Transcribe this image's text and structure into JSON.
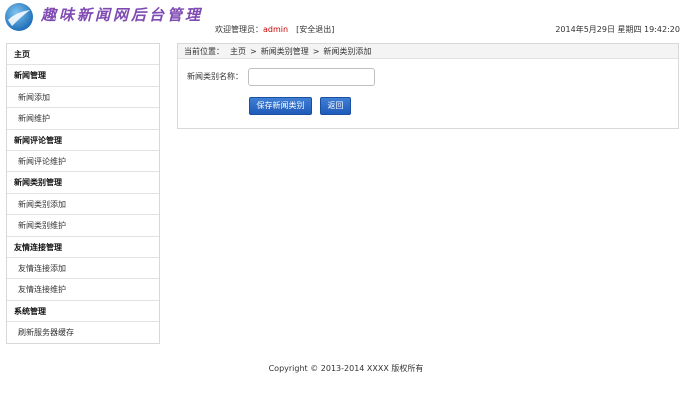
{
  "header": {
    "title": "趣味新闻网后台管理",
    "welcome_prefix": "欢迎管理员：",
    "admin_name": "admin",
    "logout_label": "[安全退出]",
    "datetime": "2014年5月29日 星期四 19:42:20"
  },
  "sidebar": {
    "items": [
      {
        "type": "group",
        "label": "主页"
      },
      {
        "type": "group",
        "label": "新闻管理"
      },
      {
        "type": "item",
        "label": "新闻添加"
      },
      {
        "type": "item",
        "label": "新闻维护"
      },
      {
        "type": "group",
        "label": "新闻评论管理"
      },
      {
        "type": "item",
        "label": "新闻评论维护"
      },
      {
        "type": "group",
        "label": "新闻类别管理"
      },
      {
        "type": "item",
        "label": "新闻类别添加"
      },
      {
        "type": "item",
        "label": "新闻类别维护"
      },
      {
        "type": "group",
        "label": "友情连接管理"
      },
      {
        "type": "item",
        "label": "友情连接添加"
      },
      {
        "type": "item",
        "label": "友情连接维护"
      },
      {
        "type": "group",
        "label": "系统管理"
      },
      {
        "type": "item",
        "label": "刷新服务器缓存"
      }
    ]
  },
  "breadcrumb": {
    "prefix": "当前位置：",
    "home": "主页",
    "sep": ">",
    "level1": "新闻类别管理",
    "level2": "新闻类别添加"
  },
  "form": {
    "name_label": "新闻类别名称：",
    "name_value": "",
    "save_label": "保存新闻类别",
    "back_label": "返回"
  },
  "footer": {
    "copyright": "Copyright © 2013-2014 XXXX 版权所有"
  },
  "colors": {
    "accent": "#1f5ab8",
    "title": "#7f4bb3",
    "admin_name": "#cc0000"
  }
}
